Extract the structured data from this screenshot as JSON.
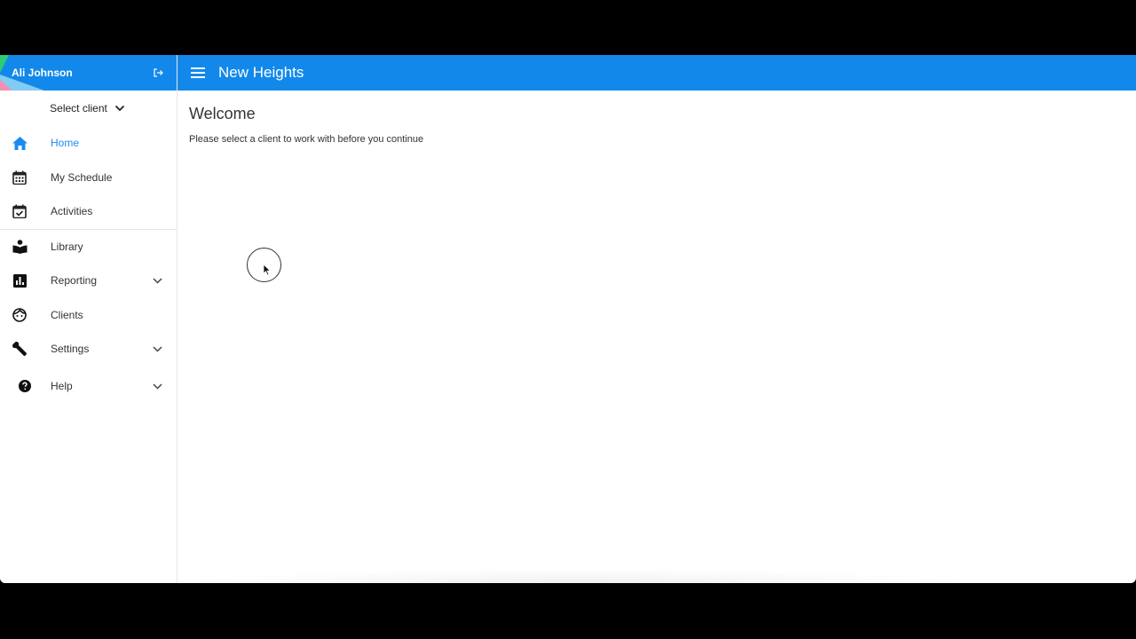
{
  "sidebar": {
    "user_name": "Ali Johnson",
    "select_client_label": "Select client",
    "items": [
      {
        "label": "Home",
        "icon": "home-icon"
      },
      {
        "label": "My Schedule",
        "icon": "calendar-icon"
      },
      {
        "label": "Activities",
        "icon": "calendar-check-icon"
      },
      {
        "label": "Library",
        "icon": "book-icon"
      },
      {
        "label": "Reporting",
        "icon": "bar-chart-icon"
      },
      {
        "label": "Clients",
        "icon": "face-icon"
      },
      {
        "label": "Settings",
        "icon": "wrench-icon"
      },
      {
        "label": "Help",
        "icon": "help-circle-icon"
      }
    ]
  },
  "header": {
    "title": "New Heights"
  },
  "main": {
    "heading": "Welcome",
    "message": "Please select a client to work with before you continue"
  },
  "colors": {
    "accent": "#1289ea",
    "active_text": "#1a8cf0"
  }
}
